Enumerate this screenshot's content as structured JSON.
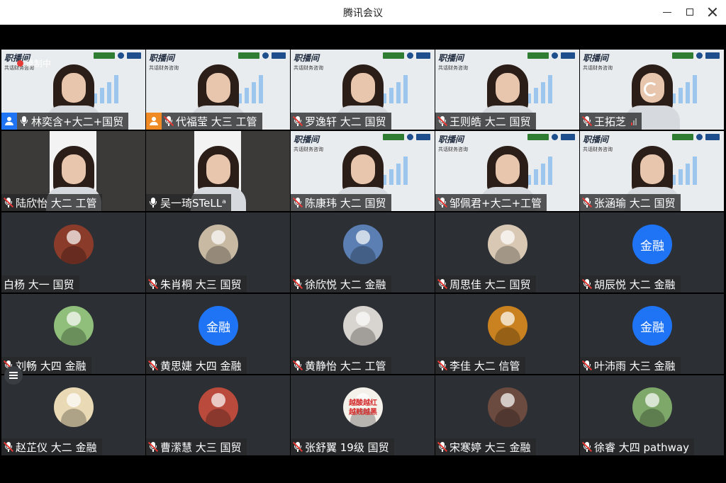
{
  "window": {
    "title": "腾讯会议"
  },
  "recording": {
    "label": "录制中"
  },
  "video_brand": {
    "title": "职播间",
    "subtitle": "共话财务咨询"
  },
  "colors": {
    "avatar_text_bg": "#1e74f5",
    "muted_slash": "#e53935",
    "cohost": "#f08a24"
  },
  "participants": [
    {
      "name": "林奕含+大二+国贸",
      "mode": "video",
      "mic": "on",
      "host": "host",
      "recording": true
    },
    {
      "name": "代福莹 大三 工管",
      "mode": "video",
      "mic": "muted",
      "host": "cohost"
    },
    {
      "name": "罗逸轩 大二 国贸",
      "mode": "video",
      "mic": "muted"
    },
    {
      "name": "王则皓 大二 国贸",
      "mode": "video",
      "mic": "muted"
    },
    {
      "name": "王拓芝",
      "mode": "video",
      "mic": "muted",
      "loading": true,
      "signal": true
    },
    {
      "name": "陆欣怡 大二 工管",
      "mode": "video-dark",
      "mic": "muted"
    },
    {
      "name": "吴一琦STeLLᵃ",
      "mode": "video-dark",
      "mic": "on"
    },
    {
      "name": "陈康玮 大二 国贸",
      "mode": "video",
      "mic": "muted"
    },
    {
      "name": "邹佩君+大二+工管",
      "mode": "video",
      "mic": "muted"
    },
    {
      "name": "张涵瑜 大二 国贸",
      "mode": "video",
      "mic": "muted"
    },
    {
      "name": "白杨 大一 国贸",
      "mode": "avatar",
      "mic": "none",
      "avatar_color": "#8a3b2a"
    },
    {
      "name": "朱肖桐 大三 国贸",
      "mode": "avatar",
      "mic": "muted",
      "avatar_color": "#c7b9a2"
    },
    {
      "name": "徐欣悦 大二 金融",
      "mode": "avatar",
      "mic": "muted",
      "avatar_color": "#5b7fb3"
    },
    {
      "name": "周思佳 大二 国贸",
      "mode": "avatar",
      "mic": "muted",
      "avatar_color": "#d9c8b4"
    },
    {
      "name": "胡辰悦 大二 金融",
      "mode": "avatar-text",
      "mic": "muted",
      "avatar_text": "金融"
    },
    {
      "name": "刘畅 大四 金融",
      "mode": "avatar",
      "mic": "muted",
      "avatar_color": "#8fbf7a"
    },
    {
      "name": "黄思婕 大四 金融",
      "mode": "avatar-text",
      "mic": "muted",
      "avatar_text": "金融"
    },
    {
      "name": "黄静怡 大二 工管",
      "mode": "avatar",
      "mic": "muted",
      "avatar_color": "#d8d4cf"
    },
    {
      "name": "李佳 大二 信管",
      "mode": "avatar",
      "mic": "muted",
      "avatar_color": "#c9821f"
    },
    {
      "name": "叶沛雨 大三 金融",
      "mode": "avatar-text",
      "mic": "muted",
      "avatar_text": "金融"
    },
    {
      "name": "赵芷仪 大二 金融",
      "mode": "avatar",
      "mic": "muted",
      "avatar_color": "#e9d9b5"
    },
    {
      "name": "曹潆慧 大三 国贸",
      "mode": "avatar",
      "mic": "muted",
      "avatar_color": "#b94a3c"
    },
    {
      "name": "张舒翼 19级 国贸",
      "mode": "avatar",
      "mic": "muted",
      "avatar_color": "#f4f1ea",
      "avatar_note": "越酸越红 越贱越黑"
    },
    {
      "name": "宋寒婷 大三 金融",
      "mode": "avatar",
      "mic": "muted",
      "avatar_color": "#6b4a3f"
    },
    {
      "name": "徐睿 大四 pathway",
      "mode": "avatar",
      "mic": "muted",
      "avatar_color": "#7ea86a"
    }
  ]
}
